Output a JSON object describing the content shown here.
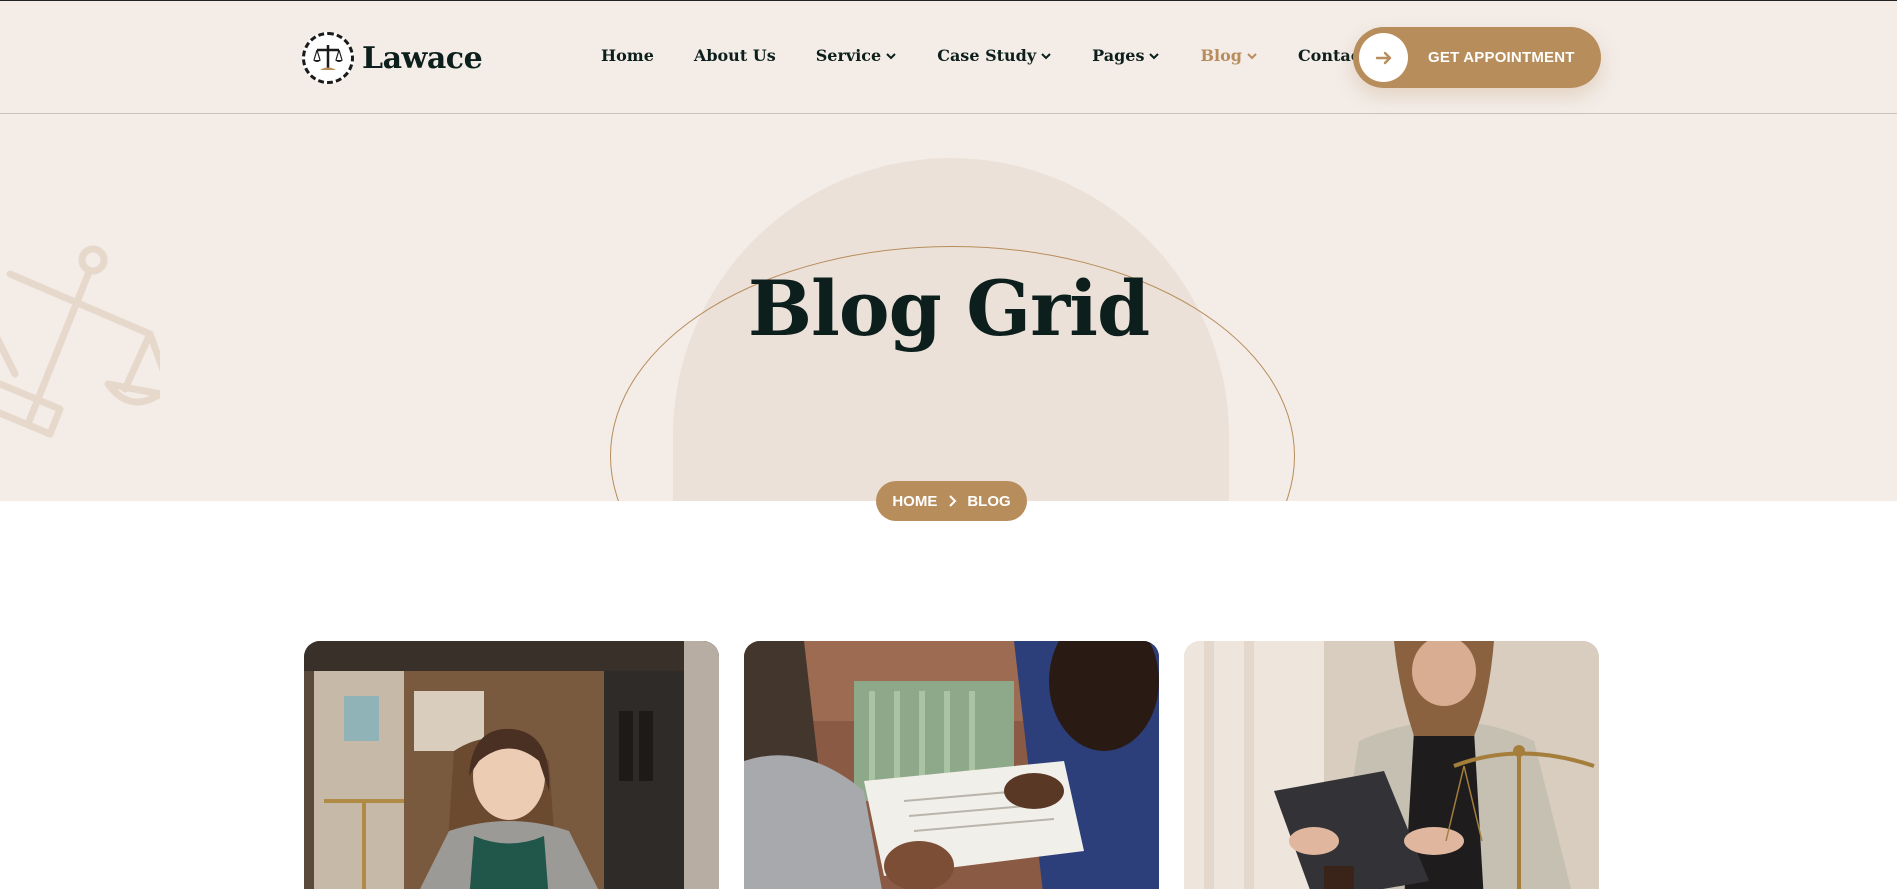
{
  "brand": {
    "name": "Lawace",
    "accent": "#b88d5c",
    "dark": "#0d1f1c"
  },
  "nav": {
    "items": [
      {
        "label": "Home",
        "dropdown": false,
        "active": false
      },
      {
        "label": "About Us",
        "dropdown": false,
        "active": false
      },
      {
        "label": "Service",
        "dropdown": true,
        "active": false
      },
      {
        "label": "Case Study",
        "dropdown": true,
        "active": false
      },
      {
        "label": "Pages",
        "dropdown": true,
        "active": false
      },
      {
        "label": "Blog",
        "dropdown": true,
        "active": true
      },
      {
        "label": "Contact Us",
        "dropdown": false,
        "active": false
      }
    ]
  },
  "cta": {
    "label": "GET APPOINTMENT",
    "icon": "arrow-right-icon"
  },
  "hero": {
    "title": "Blog Grid",
    "decoration_icon": "scale-of-justice-icon"
  },
  "breadcrumb": {
    "home": "HOME",
    "separator_icon": "chevron-right-icon",
    "current": "BLOG"
  },
  "posts": [
    {
      "image": "woman-with-glasses-at-desk-photo"
    },
    {
      "image": "document-review-handshake-photo"
    },
    {
      "image": "lawyer-with-tablet-and-scales-photo"
    }
  ]
}
